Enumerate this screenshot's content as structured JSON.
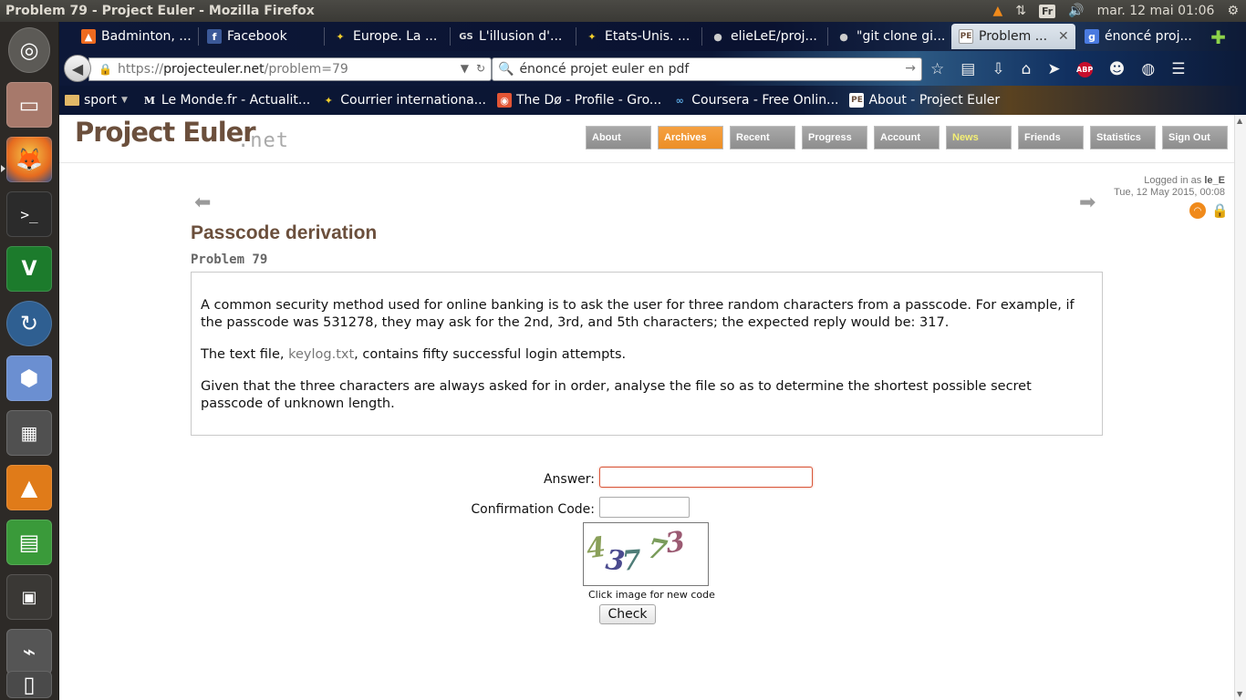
{
  "window": {
    "title": "Problem 79 - Project Euler - Mozilla Firefox"
  },
  "system_tray": {
    "keyboard_layout": "Fr",
    "datetime": "mar. 12 mai 01:06"
  },
  "tabs": [
    {
      "label": "Badminton, ...",
      "icon": "badminton-icon"
    },
    {
      "label": "Facebook",
      "icon": "facebook-icon"
    },
    {
      "label": "Europe. La ...",
      "icon": "courrier-international-icon"
    },
    {
      "label": "L'illusion d'...",
      "icon": "gs-icon"
    },
    {
      "label": "Etats-Unis. ...",
      "icon": "courrier-international-icon"
    },
    {
      "label": "elieLeE/proj...",
      "icon": "github-icon"
    },
    {
      "label": "\"git clone gi...",
      "icon": "github-icon"
    },
    {
      "label": "Problem ...",
      "icon": "project-euler-icon",
      "active": true
    },
    {
      "label": "énoncé proj...",
      "icon": "google-icon"
    }
  ],
  "navbar": {
    "url_prefix": "https://",
    "url_host": "projecteuler.net",
    "url_path": "/problem=79",
    "search_value": "énoncé projet euler en pdf"
  },
  "bookmarks": [
    {
      "label": "sport",
      "icon": "folder-icon",
      "dropdown": true
    },
    {
      "label": "Le Monde.fr - Actualit...",
      "icon": "le-monde-icon"
    },
    {
      "label": "Courrier internationa...",
      "icon": "courrier-international-icon"
    },
    {
      "label": "The Dø - Profile - Gro...",
      "icon": "last-fm-icon"
    },
    {
      "label": "Coursera - Free Onlin...",
      "icon": "coursera-icon"
    },
    {
      "label": "About - Project Euler",
      "icon": "project-euler-icon"
    }
  ],
  "site": {
    "logo": "Project Euler",
    "logo_suffix": ".net",
    "nav": [
      {
        "label": "About"
      },
      {
        "label": "Archives",
        "active": true
      },
      {
        "label": "Recent"
      },
      {
        "label": "Progress"
      },
      {
        "label": "Account"
      },
      {
        "label": "News",
        "highlight": true
      },
      {
        "label": "Friends"
      },
      {
        "label": "Statistics"
      },
      {
        "label": "Sign Out"
      }
    ],
    "login_prefix": "Logged in as",
    "login_user": "le_E",
    "login_datetime": "Tue, 12 May 2015, 00:08"
  },
  "problem": {
    "title": "Passcode derivation",
    "number": "Problem 79",
    "p1": "A common security method used for online banking is to ask the user for three random characters from a passcode. For example, if the passcode was 531278, they may ask for the 2nd, 3rd, and 5th characters; the expected reply would be: 317.",
    "p2_before": "The text file, ",
    "p2_link": "keylog.txt",
    "p2_after": ", contains fifty successful login attempts.",
    "p3": "Given that the three characters are always asked for in order, analyse the file so as to determine the shortest possible secret passcode of unknown length."
  },
  "form": {
    "answer_label": "Answer:",
    "answer_value": "",
    "confirmation_label": "Confirmation Code:",
    "confirmation_value": "",
    "captcha_chars": [
      "4",
      "3",
      "7",
      "7",
      "3"
    ],
    "captcha_colors": [
      "#8aa05a",
      "#4b4b8f",
      "#4f7d78",
      "#7a9c5b",
      "#9b5a72"
    ],
    "captcha_hint": "Click image for new code",
    "check_label": "Check"
  },
  "colors": {
    "brand_brown": "#6b4f3c",
    "nav_active_orange": "#ec8e26",
    "nav_gray": "#999999"
  }
}
